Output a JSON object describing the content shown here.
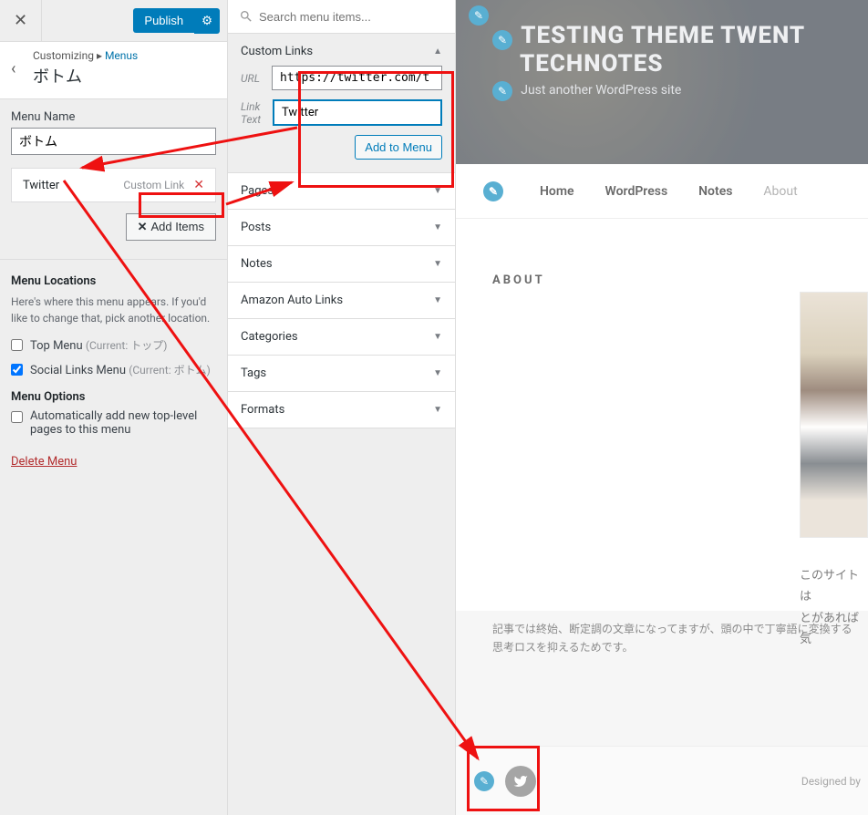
{
  "customizer": {
    "publish_label": "Publish",
    "breadcrumb_prefix": "Customizing",
    "breadcrumb_sep": "▸",
    "breadcrumb_parent": "Menus",
    "section_title": "ボトム",
    "menu_name_label": "Menu Name",
    "menu_name_value": "ボトム",
    "menu_item": {
      "title": "Twitter",
      "type": "Custom Link"
    },
    "add_items_label": "Add Items",
    "locations_heading": "Menu Locations",
    "locations_desc": "Here's where this menu appears. If you'd like to change that, pick another location.",
    "loc_top": "Top Menu",
    "loc_top_hint": "(Current: トップ)",
    "loc_social": "Social Links Menu",
    "loc_social_hint": "(Current: ボトム)",
    "options_heading": "Menu Options",
    "option_auto_add": "Automatically add new top-level pages to this menu",
    "delete_menu": "Delete Menu"
  },
  "items_panel": {
    "search_placeholder": "Search menu items...",
    "custom_links": {
      "heading": "Custom Links",
      "url_label": "URL",
      "url_value": "https://twitter.com/t",
      "linktext_label": "Link Text",
      "linktext_value": "Twitter",
      "add_button": "Add to Menu"
    },
    "sections": [
      "Pages",
      "Posts",
      "Notes",
      "Amazon Auto Links",
      "Categories",
      "Tags",
      "Formats"
    ]
  },
  "preview": {
    "hero_title_1": "TESTING THEME TWENT",
    "hero_title_2": "TECHNOTES",
    "hero_tagline": "Just another WordPress site",
    "nav": [
      "Home",
      "WordPress",
      "Notes",
      "About"
    ],
    "about_heading": "ABOUT",
    "about_text_1": "このサイトは",
    "about_text_2": "とがあれば気",
    "footer_jp": "記事では終始、断定調の文章になってますが、頭の中で丁寧語に変換する思考ロスを抑えるためです。",
    "designed_by": "Designed by "
  }
}
